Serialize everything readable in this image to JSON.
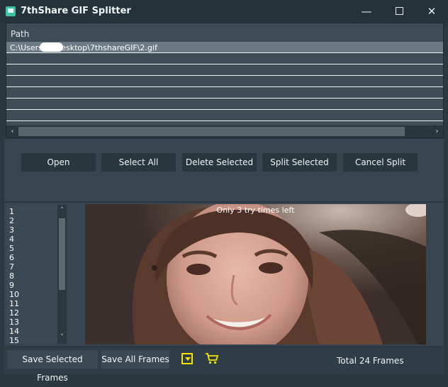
{
  "window": {
    "title": "7thShare GIF Splitter",
    "minimize_glyph": "—",
    "close_glyph": "✕"
  },
  "path_panel": {
    "header": "Path",
    "rows": [
      "C:\\Users\\ n\\Desktop\\7thshareGIF\\2.gif",
      "",
      "",
      "",
      "",
      "",
      ""
    ],
    "scroll_left": "‹",
    "scroll_right": "›"
  },
  "actions": {
    "open": "Open",
    "select_all": "Select All",
    "delete_selected": "Delete Selected",
    "split_selected": "Split Selected",
    "cancel_split": "Cancel Split"
  },
  "frames": {
    "items": [
      "1",
      "2",
      "3",
      "4",
      "5",
      "6",
      "7",
      "8",
      "9",
      "10",
      "11",
      "12",
      "13",
      "14",
      "15"
    ],
    "scroll_up": "˄",
    "scroll_down": "˅"
  },
  "preview": {
    "watermark": "Only 3 try times left"
  },
  "bottom": {
    "save_selected": "Save Selected Frames",
    "save_all": "Save All Frames",
    "total": "Total 24 Frames"
  },
  "colors": {
    "accent_yellow": "#f5e500",
    "background": "#2b3840",
    "panel": "#364550"
  },
  "icons": {
    "app": "app-icon",
    "dropdown": "dropdown-icon",
    "cart": "cart-icon"
  }
}
